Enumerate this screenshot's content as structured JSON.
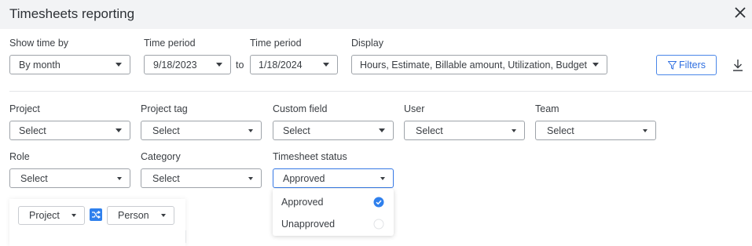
{
  "header": {
    "title": "Timesheets reporting"
  },
  "controls": {
    "show_time_by": {
      "label": "Show time by",
      "value": "By month"
    },
    "time_period_start": {
      "label": "Time period",
      "value": "9/18/2023"
    },
    "to_label": "to",
    "time_period_end": {
      "label": "Time period",
      "value": "1/18/2024"
    },
    "display": {
      "label": "Display",
      "value": "Hours, Estimate, Billable amount, Utilization, Budget"
    },
    "filters_label": "Filters"
  },
  "filters": {
    "project": {
      "label": "Project",
      "value": "Select"
    },
    "project_tag": {
      "label": "Project tag",
      "value": "Select"
    },
    "custom_field": {
      "label": "Custom field",
      "value": "Select"
    },
    "user": {
      "label": "User",
      "value": "Select"
    },
    "team": {
      "label": "Team",
      "value": "Select"
    },
    "role": {
      "label": "Role",
      "value": "Select"
    },
    "category": {
      "label": "Category",
      "value": "Select"
    },
    "timesheet_status": {
      "label": "Timesheet status",
      "value": "Approved"
    }
  },
  "status_options": [
    {
      "label": "Approved",
      "checked": true
    },
    {
      "label": "Unapproved",
      "checked": false
    }
  ],
  "grouping": {
    "first": "Project",
    "second": "Person"
  },
  "colors": {
    "accent": "#2f80ed",
    "header_bg": "#f2f3f5",
    "border": "#9ea3a9"
  },
  "icons": {
    "close": "close-icon",
    "filter": "filter-icon",
    "download": "download-icon",
    "swap": "swap-icon",
    "check": "check-circle-icon"
  }
}
